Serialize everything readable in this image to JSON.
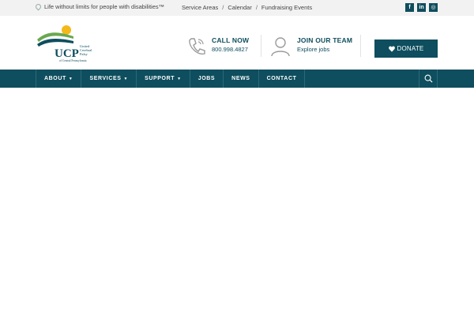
{
  "topbar": {
    "tagline": "Life without limits for people with disabilities™",
    "links": [
      "Service Areas",
      "Calendar",
      "Fundraising Events"
    ],
    "social": [
      {
        "icon": "facebook-icon",
        "glyph": "f"
      },
      {
        "icon": "linkedin-icon",
        "glyph": "in"
      },
      {
        "icon": "instagram-icon",
        "glyph": "◎"
      }
    ]
  },
  "logo": {
    "mark": "UCP",
    "line1": "United",
    "line2": "Cerebral",
    "line3": "Palsy",
    "sub": "of Central Pennsylvania"
  },
  "call": {
    "title": "CALL NOW",
    "number": "800.998.4827"
  },
  "team": {
    "title": "JOIN OUR TEAM",
    "sub": "Explore jobs"
  },
  "donate": {
    "label": "DONATE"
  },
  "nav": {
    "items": [
      {
        "label": "ABOUT",
        "has_dropdown": true
      },
      {
        "label": "SERVICES",
        "has_dropdown": true
      },
      {
        "label": "SUPPORT",
        "has_dropdown": true
      },
      {
        "label": "JOBS",
        "has_dropdown": false
      },
      {
        "label": "NEWS",
        "has_dropdown": false
      },
      {
        "label": "CONTACT",
        "has_dropdown": false
      }
    ]
  },
  "colors": {
    "brand": "#0e4e5e",
    "accent_yellow": "#f3b81c",
    "accent_green": "#6aa84f"
  }
}
